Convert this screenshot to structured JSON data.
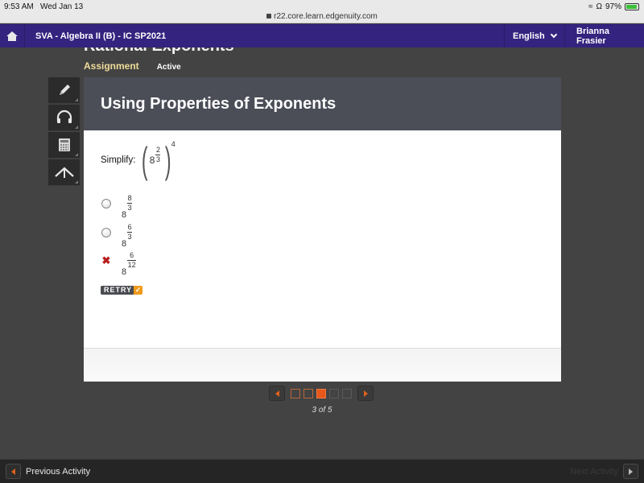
{
  "status_bar": {
    "time": "9:53 AM",
    "date": "Wed Jan 13",
    "url": "r22.core.learn.edgenuity.com",
    "battery": "97%"
  },
  "nav": {
    "course": "SVA - Algebra II (B) - IC SP2021",
    "language": "English",
    "user": "Brianna Frasier"
  },
  "lesson": {
    "title": "Rational Exponents",
    "assignment_label": "Assignment",
    "status": "Active"
  },
  "tools": [
    {
      "icon": "pencil-icon"
    },
    {
      "icon": "headphones-icon"
    },
    {
      "icon": "calculator-icon"
    },
    {
      "icon": "reference-icon"
    }
  ],
  "card": {
    "title": "Using Properties of Exponents",
    "prompt_label": "Simplify:",
    "expression": {
      "base": "8",
      "inner_num": "2",
      "inner_den": "3",
      "outer_exp": "4"
    },
    "options": [
      {
        "base": "8",
        "num": "8",
        "den": "3",
        "state": "unselected"
      },
      {
        "base": "8",
        "num": "6",
        "den": "3",
        "state": "unselected"
      },
      {
        "base": "8",
        "num": "6",
        "den": "12",
        "state": "incorrect"
      }
    ],
    "retry_label": "RETRY"
  },
  "pager": {
    "label": "3 of 5",
    "current": 3,
    "total": 5,
    "completed": [
      1,
      2
    ]
  },
  "bottom": {
    "prev_label": "Previous Activity",
    "next_label": "Next Activity"
  },
  "colors": {
    "nav_bg": "#34237f",
    "accent_orange": "#e7561a",
    "card_header": "#4b4d57",
    "incorrect": "#b91d1d"
  }
}
